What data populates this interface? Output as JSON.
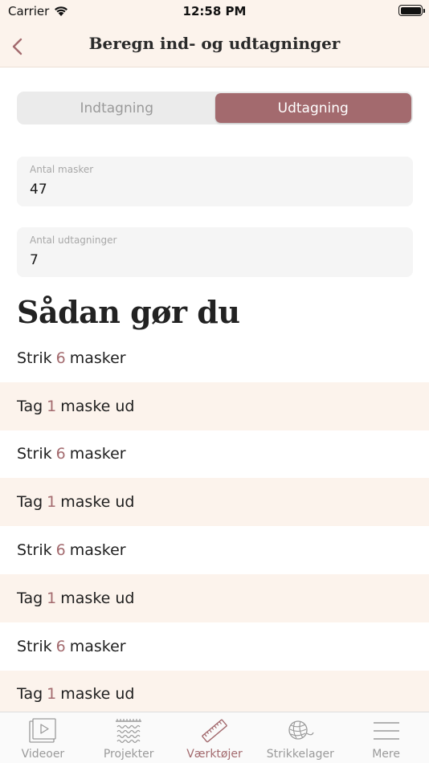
{
  "status_bar": {
    "carrier": "Carrier",
    "time": "12:58 PM"
  },
  "nav": {
    "title": "Beregn ind- og udtagninger"
  },
  "segmented": {
    "options": [
      "Indtagning",
      "Udtagning"
    ],
    "selected": "Udtagning"
  },
  "fields": {
    "stitches": {
      "label": "Antal masker",
      "value": "47"
    },
    "increases": {
      "label": "Antal udtagninger",
      "value": "7"
    }
  },
  "instructions": {
    "title": "Sådan gør du",
    "steps": [
      {
        "pre": "Strik",
        "num": "6",
        "post": "masker"
      },
      {
        "pre": "Tag",
        "num": "1",
        "post": "maske ud"
      },
      {
        "pre": "Strik",
        "num": "6",
        "post": "masker"
      },
      {
        "pre": "Tag",
        "num": "1",
        "post": "maske ud"
      },
      {
        "pre": "Strik",
        "num": "6",
        "post": "masker"
      },
      {
        "pre": "Tag",
        "num": "1",
        "post": "maske ud"
      },
      {
        "pre": "Strik",
        "num": "6",
        "post": "masker"
      },
      {
        "pre": "Tag",
        "num": "1",
        "post": "maske ud"
      }
    ]
  },
  "tabs": [
    {
      "label": "Videoer",
      "icon": "video-icon"
    },
    {
      "label": "Projekter",
      "icon": "knitting-icon"
    },
    {
      "label": "Værktøjer",
      "icon": "ruler-icon",
      "active": true
    },
    {
      "label": "Strikkelager",
      "icon": "yarn-ball-icon"
    },
    {
      "label": "Mere",
      "icon": "menu-icon"
    }
  ],
  "colors": {
    "accent": "#a36a6e",
    "tint": "#fcf3ec",
    "inactive": "#9a9a9a"
  }
}
